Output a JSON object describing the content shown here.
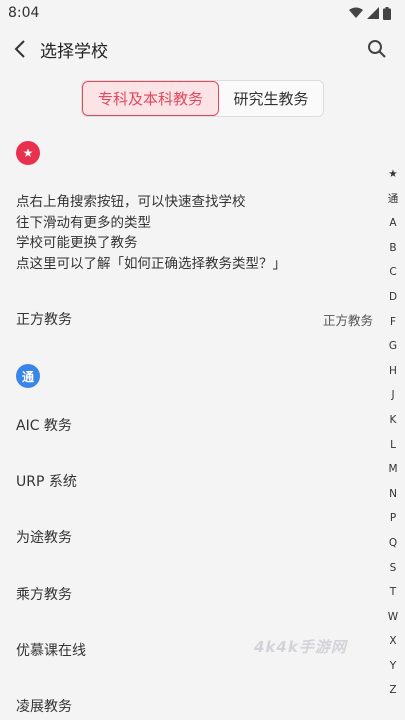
{
  "status_bar": {
    "time": "8:04",
    "icons": [
      "wifi-icon",
      "signal-icon",
      "battery-icon"
    ]
  },
  "app_bar": {
    "title": "选择学校",
    "back_icon": "back-arrow-icon",
    "search_icon": "search-icon"
  },
  "tabs": [
    {
      "label": "专科及本科教务",
      "active": true
    },
    {
      "label": "研究生教务",
      "active": false
    }
  ],
  "favorites_badge": "★",
  "tips": [
    "点右上角搜索按钮，可以快速查找学校",
    "往下滑动有更多的类型",
    "学校可能更换了教务",
    "点这里可以了解「如何正确选择教务类型？」"
  ],
  "favorite_row": {
    "label": "正方教务",
    "value": "正方教务"
  },
  "common_badge": "通",
  "common_items": [
    "AIC 教务",
    "URP 系统",
    "为途教务",
    "乘方教务",
    "优慕课在线",
    "凌展教务"
  ],
  "index_letters": [
    "★",
    "通",
    "A",
    "B",
    "C",
    "D",
    "F",
    "G",
    "H",
    "J",
    "K",
    "L",
    "M",
    "N",
    "P",
    "Q",
    "S",
    "T",
    "W",
    "X",
    "Y",
    "Z"
  ],
  "watermark": "4k4k手游网",
  "colors": {
    "accent": "#e2495f",
    "blue_badge": "#3a86e8",
    "background": "#f4f4f4"
  }
}
